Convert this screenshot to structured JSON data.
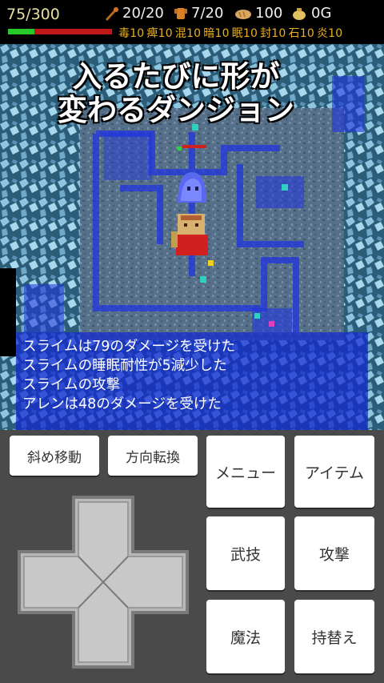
{
  "hud": {
    "hp": "75/300",
    "hp_fraction": 0.25,
    "weapon_durability": "20/20",
    "armor_durability": "7/20",
    "food": "100",
    "gold": "0G",
    "resistances": [
      "毒10",
      "痺10",
      "混10",
      "暗10",
      "眠10",
      "封10",
      "石10",
      "炎10"
    ]
  },
  "caption": {
    "line1": "入るたびに形が",
    "line2": "変わるダンジョン"
  },
  "log": [
    "スライムは79のダメージを受けた",
    "スライムの睡眠耐性が5減少した",
    "スライムの攻撃",
    "アレンは48のダメージを受けた"
  ],
  "buttons": {
    "diagonal": "斜め移動",
    "turn": "方向転換",
    "menu": "メニュー",
    "item": "アイテム",
    "skill": "武技",
    "attack": "攻撃",
    "magic": "魔法",
    "swap": "持替え"
  },
  "colors": {
    "hp_good": "#28c828",
    "hp_lost": "#c01818",
    "log_bg": "#1428d2",
    "resist_text": "#e8b020"
  }
}
